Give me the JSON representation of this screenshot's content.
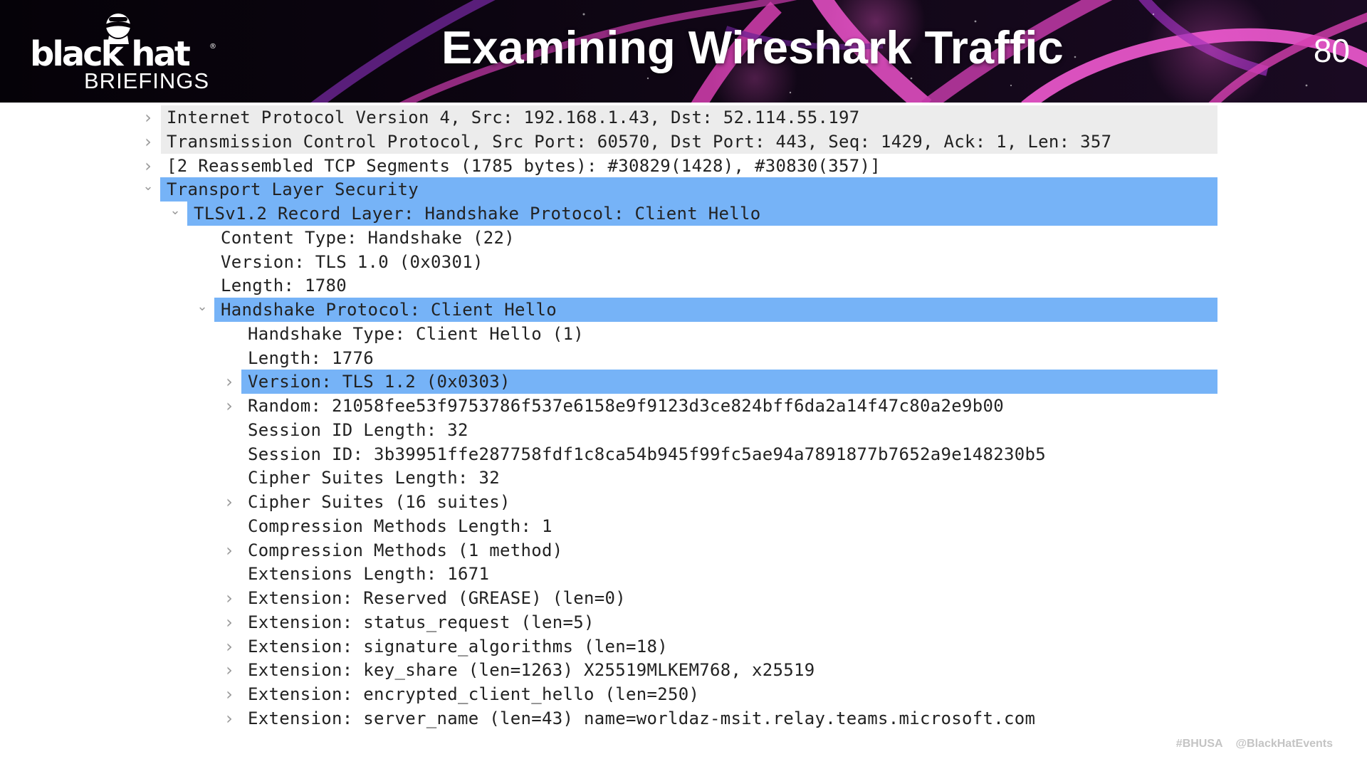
{
  "header": {
    "logo_word": "black hat",
    "logo_registered": "®",
    "logo_sub": "BRIEFINGS",
    "title": "Examining Wireshark Traffic",
    "page_number": "80",
    "accent_colors": [
      "#d63fb0",
      "#7a2aa8",
      "#f05ad0"
    ]
  },
  "selection_color": "#76b3f7",
  "stripe_color": "#ececec",
  "tree": {
    "rows": [
      {
        "text": "Internet Protocol Version 4, Src: 192.168.1.43, Dst: 52.114.55.197",
        "twisty": "collapsed",
        "level": 0,
        "state": "grey"
      },
      {
        "text": "Transmission Control Protocol, Src Port: 60570, Dst Port: 443, Seq: 1429, Ack: 1, Len: 357",
        "twisty": "collapsed",
        "level": 0,
        "state": "grey"
      },
      {
        "text": "[2 Reassembled TCP Segments (1785 bytes): #30829(1428), #30830(357)]",
        "twisty": "collapsed",
        "level": 0,
        "state": "plain"
      },
      {
        "text": "Transport Layer Security",
        "twisty": "expanded",
        "level": 0,
        "state": "selected"
      },
      {
        "text": "TLSv1.2 Record Layer: Handshake Protocol: Client Hello",
        "twisty": "expanded",
        "level": 1,
        "state": "selected"
      },
      {
        "text": "Content Type: Handshake (22)",
        "twisty": "none",
        "level": 2,
        "state": "plain"
      },
      {
        "text": "Version: TLS 1.0 (0x0301)",
        "twisty": "none",
        "level": 2,
        "state": "plain"
      },
      {
        "text": "Length: 1780",
        "twisty": "none",
        "level": 2,
        "state": "plain"
      },
      {
        "text": "Handshake Protocol: Client Hello",
        "twisty": "expanded",
        "level": 2,
        "state": "selected"
      },
      {
        "text": "Handshake Type: Client Hello (1)",
        "twisty": "none",
        "level": 3,
        "state": "plain"
      },
      {
        "text": "Length: 1776",
        "twisty": "none",
        "level": 3,
        "state": "plain"
      },
      {
        "text": "Version: TLS 1.2 (0x0303)",
        "twisty": "collapsed",
        "level": 3,
        "state": "selected"
      },
      {
        "text": "Random: 21058fee53f9753786f537e6158e9f9123d3ce824bff6da2a14f47c80a2e9b00",
        "twisty": "collapsed",
        "level": 3,
        "state": "plain"
      },
      {
        "text": "Session ID Length: 32",
        "twisty": "none",
        "level": 3,
        "state": "plain"
      },
      {
        "text": "Session ID: 3b39951ffe287758fdf1c8ca54b945f99fc5ae94a7891877b7652a9e148230b5",
        "twisty": "none",
        "level": 3,
        "state": "plain"
      },
      {
        "text": "Cipher Suites Length: 32",
        "twisty": "none",
        "level": 3,
        "state": "plain"
      },
      {
        "text": "Cipher Suites (16 suites)",
        "twisty": "collapsed",
        "level": 3,
        "state": "plain"
      },
      {
        "text": "Compression Methods Length: 1",
        "twisty": "none",
        "level": 3,
        "state": "plain"
      },
      {
        "text": "Compression Methods (1 method)",
        "twisty": "collapsed",
        "level": 3,
        "state": "plain"
      },
      {
        "text": "Extensions Length: 1671",
        "twisty": "none",
        "level": 3,
        "state": "plain"
      },
      {
        "text": "Extension: Reserved (GREASE) (len=0)",
        "twisty": "collapsed",
        "level": 3,
        "state": "plain"
      },
      {
        "text": "Extension: status_request (len=5)",
        "twisty": "collapsed",
        "level": 3,
        "state": "plain"
      },
      {
        "text": "Extension: signature_algorithms (len=18)",
        "twisty": "collapsed",
        "level": 3,
        "state": "plain"
      },
      {
        "text": "Extension: key_share (len=1263) X25519MLKEM768, x25519",
        "twisty": "collapsed",
        "level": 3,
        "state": "plain"
      },
      {
        "text": "Extension: encrypted_client_hello (len=250)",
        "twisty": "collapsed",
        "level": 3,
        "state": "plain"
      },
      {
        "text": "Extension: server_name (len=43) name=worldaz-msit.relay.teams.microsoft.com",
        "twisty": "collapsed",
        "level": 3,
        "state": "plain"
      }
    ]
  },
  "footer": {
    "hashtag": "#BHUSA",
    "handle": "@BlackHatEvents"
  }
}
